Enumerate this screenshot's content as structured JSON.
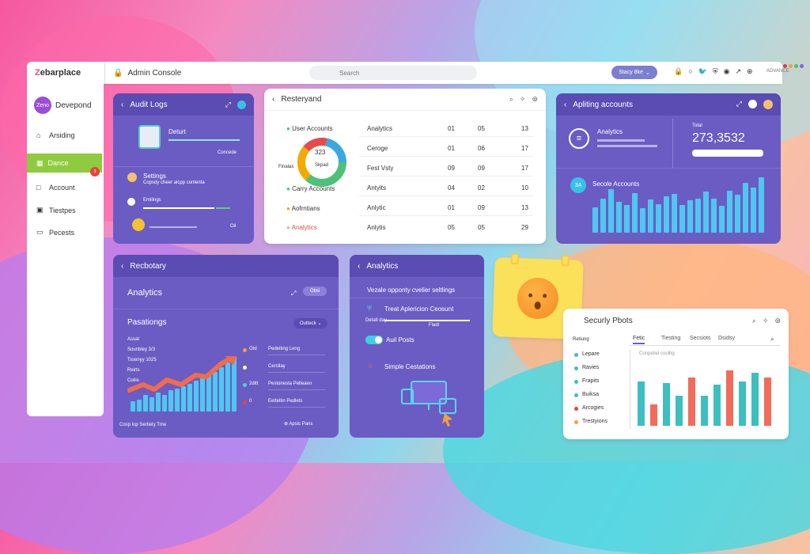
{
  "appbar": {
    "logo_prefix": "Z",
    "logo_rest": "ebarplace",
    "console_label": "Admin Console",
    "search_placeholder": "Search",
    "user_pill": "Stacy 8ke",
    "admin_label": "ADVANCE",
    "dot_colors": [
      "#e23b3b",
      "#f0a23a",
      "#4cc06a",
      "#8b5cf6"
    ]
  },
  "sidebar": {
    "brand_badge": "Zeno",
    "brand_name": "Devepond",
    "items": [
      {
        "label": "Arsiding",
        "icon": "home-icon"
      },
      {
        "label": "Dance",
        "icon": "grid-icon"
      },
      {
        "label": "Account",
        "icon": "person-icon"
      },
      {
        "label": "Tiestpes",
        "icon": "calendar-icon"
      },
      {
        "label": "Pecests",
        "icon": "monitor-icon"
      }
    ],
    "active_index": 1,
    "badge_count": "3"
  },
  "audit": {
    "title": "Audit Logs",
    "deturt_label": "Deturt",
    "cursor_text": "Concede",
    "settings_title": "Settings",
    "settings_sub": "Copsdy cheer alcpp contenta",
    "emailings": "Emilings",
    "oil": "Oil"
  },
  "table": {
    "title": "Resteryand",
    "legend": [
      {
        "label": "User Accounts",
        "color": "#4dc07a"
      },
      {
        "label": "Carry Accounts",
        "color": "#4dc07a"
      },
      {
        "label": "Aofrntians",
        "color": "#f2a900"
      },
      {
        "label": "Analytics",
        "color": "#e54b4b"
      }
    ],
    "donut_center": "323",
    "donut_sub": "Skpad",
    "donut_left": "Finalas",
    "rows": [
      {
        "name": "Analytics",
        "a": "01",
        "b": "05",
        "c": "13"
      },
      {
        "name": "Ceroge",
        "a": "01",
        "b": "06",
        "c": "17"
      },
      {
        "name": "Fest Vsty",
        "a": "09",
        "b": "09",
        "c": "17"
      },
      {
        "name": "Antylts",
        "a": "04",
        "b": "02",
        "c": "10"
      },
      {
        "name": "Anlytic",
        "a": "01",
        "b": "09",
        "c": "13"
      },
      {
        "name": "Anlytis",
        "a": "05",
        "b": "05",
        "c": "29"
      }
    ]
  },
  "accounts": {
    "title": "Apliting accounts",
    "analytics_label": "Analytics",
    "total_label": "Total",
    "total_value": "273,3532",
    "section_badge": "3A",
    "section_title": "Secole Accounts",
    "bars": [
      0.45,
      0.62,
      0.78,
      0.55,
      0.5,
      0.72,
      0.44,
      0.6,
      0.52,
      0.66,
      0.7,
      0.5,
      0.58,
      0.62,
      0.74,
      0.62,
      0.48,
      0.76,
      0.68,
      0.9,
      0.82,
      1.0
    ]
  },
  "recovery": {
    "title": "Recbotary",
    "analytics_label": "Analytics",
    "pill_label": "Obsi",
    "section_title": "Pasationgs",
    "select_label": "Outteck",
    "stats": [
      "Assat",
      "Sounbley 3/3",
      "Tssenyy 1025",
      "Reirts",
      "Cotre"
    ],
    "legend": [
      {
        "value": "Otd",
        "label": "Pedeiting Leng",
        "color": "#f2a33a"
      },
      {
        "value": "",
        "label": "Cersllay",
        "color": "#ffffff"
      },
      {
        "value": "2ditt",
        "label": "Pestonesta Pelleaeo",
        "color": "#4fd0e0"
      },
      {
        "value": "0",
        "label": "Eetteltin Pedlets",
        "color": "#e9433f"
      }
    ],
    "footer_left": "Cosp lop Sertiety Tme",
    "footer_right": "Apsis Pans",
    "bars": [
      0.18,
      0.22,
      0.3,
      0.26,
      0.34,
      0.3,
      0.38,
      0.42,
      0.46,
      0.5,
      0.55,
      0.6,
      0.66,
      0.72,
      0.8,
      0.88,
      1.0
    ]
  },
  "analytics": {
    "title": "Analytics",
    "headline": "Vezale opponty cvelier seltlings",
    "item1": "Treat Aplericion Ceosunt",
    "item1_small": "Detatl day",
    "item1_label": "Fladl",
    "item2": "Auil Posts",
    "item3": "Simple Cestations"
  },
  "security": {
    "title": "Securly Pbots",
    "tabs": [
      "Fetic",
      "Tiesting",
      "Secsiots",
      "Dsidsy"
    ],
    "legend_title": "Retiung",
    "legend": [
      {
        "label": "Lepare",
        "color": "#3ebfbf"
      },
      {
        "label": "Ravies",
        "color": "#3ebfbf"
      },
      {
        "label": "Frapits",
        "color": "#3ebfbf"
      },
      {
        "label": "Buiksa",
        "color": "#3ebfbf"
      },
      {
        "label": "Arcogies",
        "color": "#e9433f"
      },
      {
        "label": "Trestyions",
        "color": "#f2a33a"
      }
    ],
    "chart_caption": "Conpetiel coulbg",
    "bars": [
      {
        "v": 0.62,
        "c": "#3ebfbf"
      },
      {
        "v": 0.3,
        "c": "#f26b5b"
      },
      {
        "v": 0.6,
        "c": "#3ebfbf"
      },
      {
        "v": 0.42,
        "c": "#3ebfbf"
      },
      {
        "v": 0.68,
        "c": "#f26b5b"
      },
      {
        "v": 0.42,
        "c": "#3ebfbf"
      },
      {
        "v": 0.58,
        "c": "#3ebfbf"
      },
      {
        "v": 0.78,
        "c": "#f26b5b"
      },
      {
        "v": 0.62,
        "c": "#3ebfbf"
      },
      {
        "v": 0.74,
        "c": "#3ebfbf"
      },
      {
        "v": 0.68,
        "c": "#f26b5b"
      }
    ]
  }
}
